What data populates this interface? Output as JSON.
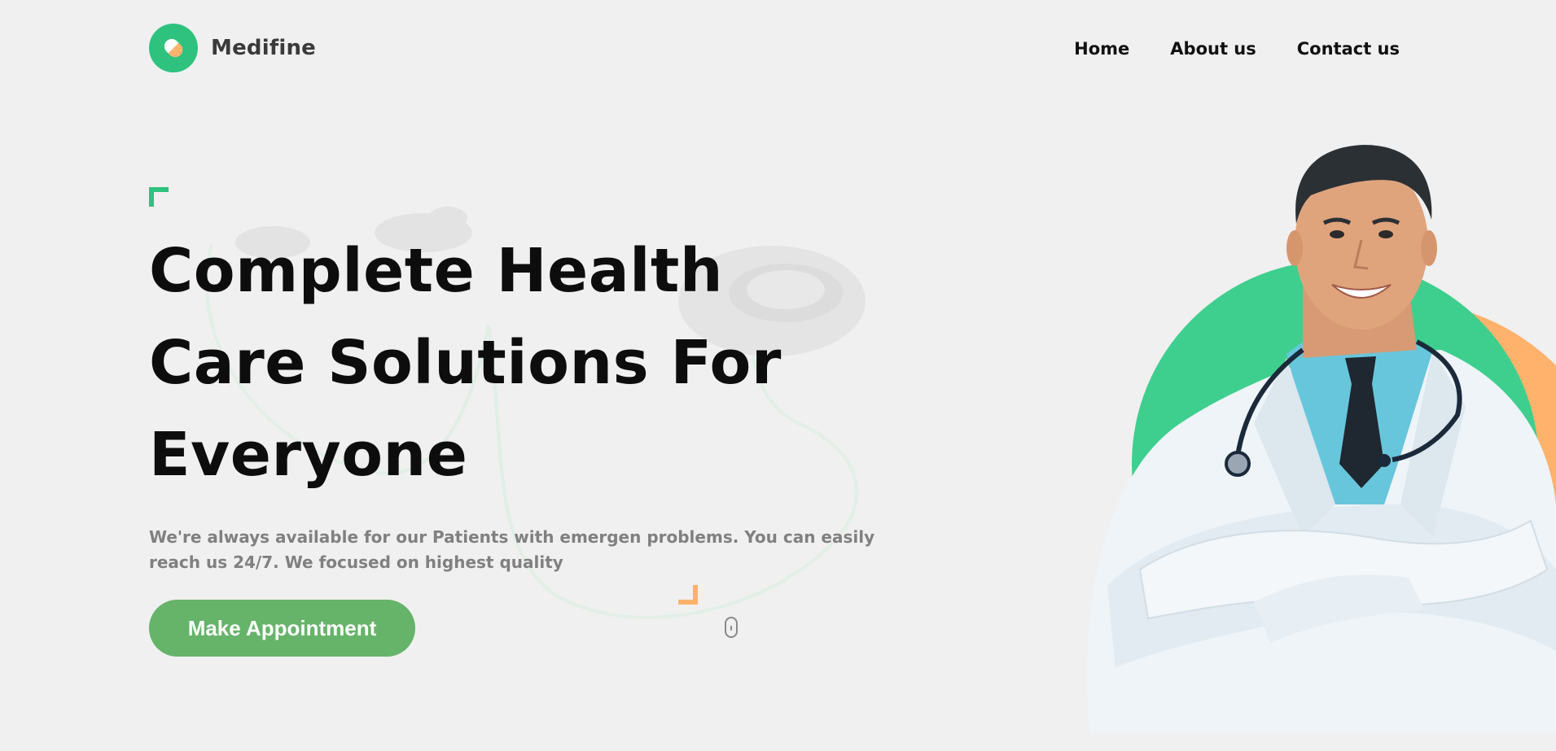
{
  "brand": {
    "name": "Medifine",
    "logo_icon": "pill-icon",
    "accent_color": "#2ec27e",
    "secondary_color": "#ffb26b"
  },
  "nav": {
    "items": [
      {
        "label": "Home"
      },
      {
        "label": "About us"
      },
      {
        "label": "Contact us"
      }
    ]
  },
  "hero": {
    "title_lines": [
      "Complete Health",
      "Care Solutions For",
      "Everyone"
    ],
    "description": "We're always available for our Patients with emergen problems. You can easily reach us 24/7. We focused on highest quality",
    "cta_label": "Make Appointment",
    "cta_color": "#66b36a",
    "scroll_icon": "mouse-scroll-icon",
    "image": "doctor-portrait"
  }
}
